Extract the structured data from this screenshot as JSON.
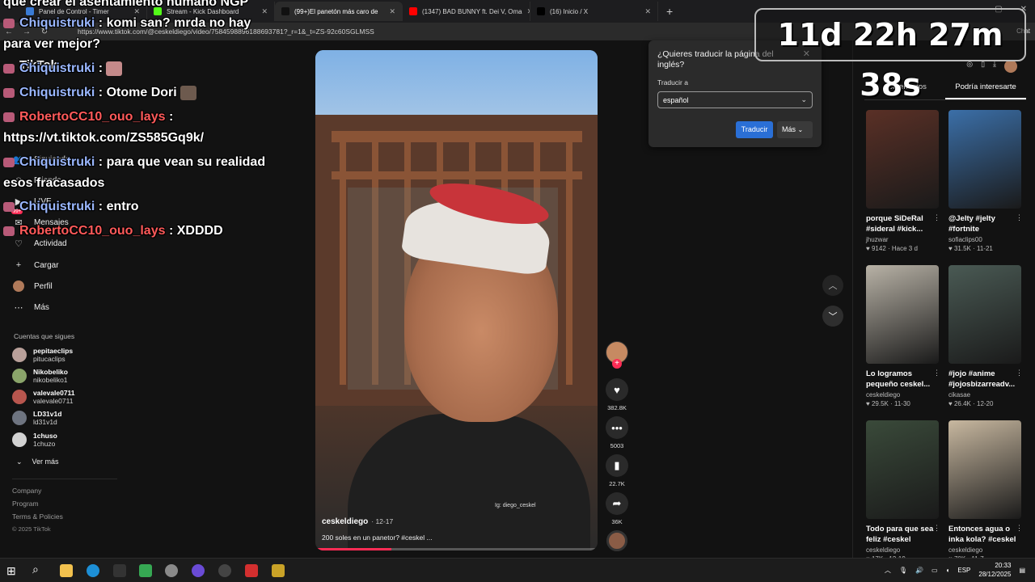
{
  "browser": {
    "tabs": [
      {
        "label": "Panel de Control - Timer",
        "color": "#3a7bd5",
        "active": false
      },
      {
        "label": "Stream - Kick Dashboard",
        "color": "#53fc18",
        "active": false
      },
      {
        "label": "(99+)El panetón más caro de",
        "color": "#111111",
        "active": true
      },
      {
        "label": "(1347) BAD BUNNY ft. Dei V, Oma",
        "color": "#ff0000",
        "active": false
      },
      {
        "label": "(16) Inicio / X",
        "color": "#000000",
        "active": false
      }
    ],
    "url": "https://www.tiktok.com/@ceskeldiego/video/7584598896188693781?_r=1&_t=ZS-92c60SGLMSS",
    "chat_label": "Chat"
  },
  "timer": "11d 22h 27m 38s",
  "chat": {
    "lines": [
      {
        "kind": "cont",
        "text": "que crear el asentamiento humano NGP"
      },
      {
        "kind": "msg",
        "user": "Chiquistruki",
        "color": "blue",
        "text": ": komi san? mrda no hay"
      },
      {
        "kind": "cont",
        "text": "para ver mejor?"
      },
      {
        "kind": "msg",
        "user": "Chiquistruki",
        "color": "blue",
        "text": ":"
      },
      {
        "kind": "msg",
        "user": "Chiquistruki",
        "color": "blue",
        "text": ": Otome Dori"
      },
      {
        "kind": "msg",
        "user": "RobertoCC10_ouo_lays",
        "color": "red",
        "text": ":"
      },
      {
        "kind": "cont",
        "text": "https://vt.tiktok.com/ZS585Gq9k/"
      },
      {
        "kind": "msg",
        "user": "Chiquistruki",
        "color": "blue",
        "text": ": para que vean su realidad"
      },
      {
        "kind": "cont",
        "text": "esos fracasados"
      },
      {
        "kind": "msg",
        "user": "Chiquistruki",
        "color": "blue",
        "text": ": entro"
      },
      {
        "kind": "msg",
        "user": "RobertoCC10_ouo_lays",
        "color": "red",
        "text": ": XDDDD"
      }
    ]
  },
  "sidebar": {
    "logo": "TikTok",
    "menu": [
      {
        "label": "Siguiendo",
        "icon": "following-icon"
      },
      {
        "label": "Friends",
        "icon": "friends-icon"
      },
      {
        "label": "LIVE",
        "icon": "live-icon"
      },
      {
        "label": "Mensajes",
        "icon": "messages-icon"
      },
      {
        "label": "Actividad",
        "icon": "activity-icon"
      },
      {
        "label": "Cargar",
        "icon": "upload-icon"
      },
      {
        "label": "Perfil",
        "icon": "profile-icon"
      },
      {
        "label": "Más",
        "icon": "more-icon"
      }
    ],
    "badge": "99+",
    "following_title": "Cuentas que sigues",
    "following": [
      {
        "name": "pepitaeclips",
        "handle": "pitucaclips",
        "color": "#b9a09a"
      },
      {
        "name": "Nikobeliko",
        "handle": "nikobeliko1",
        "color": "#8aa46a"
      },
      {
        "name": "valevale0711",
        "handle": "valevale0711",
        "color": "#b8564e"
      },
      {
        "name": "LD31v1d",
        "handle": "ld31v1d",
        "color": "#6e7480"
      },
      {
        "name": "1chuso",
        "handle": "1chuzo",
        "color": "#d2d2d2"
      }
    ],
    "ver_mas": "Ver más",
    "footer": [
      "Company",
      "Program",
      "Terms & Policies"
    ],
    "copyright": "© 2025 TikTok"
  },
  "video": {
    "author": "ceskeldiego",
    "date": "· 12-17",
    "caption": "200 soles en un panetor? #ceskel ...",
    "watermark": "Ig: diego_ceskel",
    "progress": 0.27
  },
  "actions": {
    "likes": "382.8K",
    "comments": "5003",
    "saves": "22.7K",
    "shares": "36K"
  },
  "translate": {
    "title": "¿Quieres traducir la página del inglés?",
    "label": "Traducir a",
    "language": "español",
    "translate_btn": "Traducir",
    "more_btn": "Más"
  },
  "right_panel": {
    "tabs": [
      "Comentarios",
      "Podría interesarte"
    ],
    "active_tab": 1,
    "cards": [
      {
        "title": "porque SiDeRal #sideral #kick...",
        "author": "jhuzwar",
        "stats": "♥ 9142 · Hace 3 d",
        "thumb": "#5a3026"
      },
      {
        "title": "@Jelty #jelty #fortnite",
        "author": "sofiaclips00",
        "stats": "♥ 31.5K · 11-21",
        "thumb": "#3b6fa8"
      },
      {
        "title": "Lo logramos pequeño ceskel...",
        "author": "ceskeldiego",
        "stats": "♥ 29.5K · 11-30",
        "thumb": "#b8b2a6"
      },
      {
        "title": "#jojo #anime #jojosbizarreadv...",
        "author": "cikasae",
        "stats": "♥ 26.4K · 12-20",
        "thumb": "#4a5a54"
      },
      {
        "title": "Todo para que sea feliz #ceskel",
        "author": "ceskeldiego",
        "stats": "♥ 17K · 12-19",
        "thumb": "#3a4a3a"
      },
      {
        "title": "Entonces agua o inka kola? #ceskel",
        "author": "ceskeldiego",
        "stats": "♥ 70K · 11-7",
        "thumb": "#c8b8a0"
      }
    ]
  },
  "taskbar": {
    "lang": "ESP",
    "time": "20:33",
    "date": "28/12/2025"
  }
}
